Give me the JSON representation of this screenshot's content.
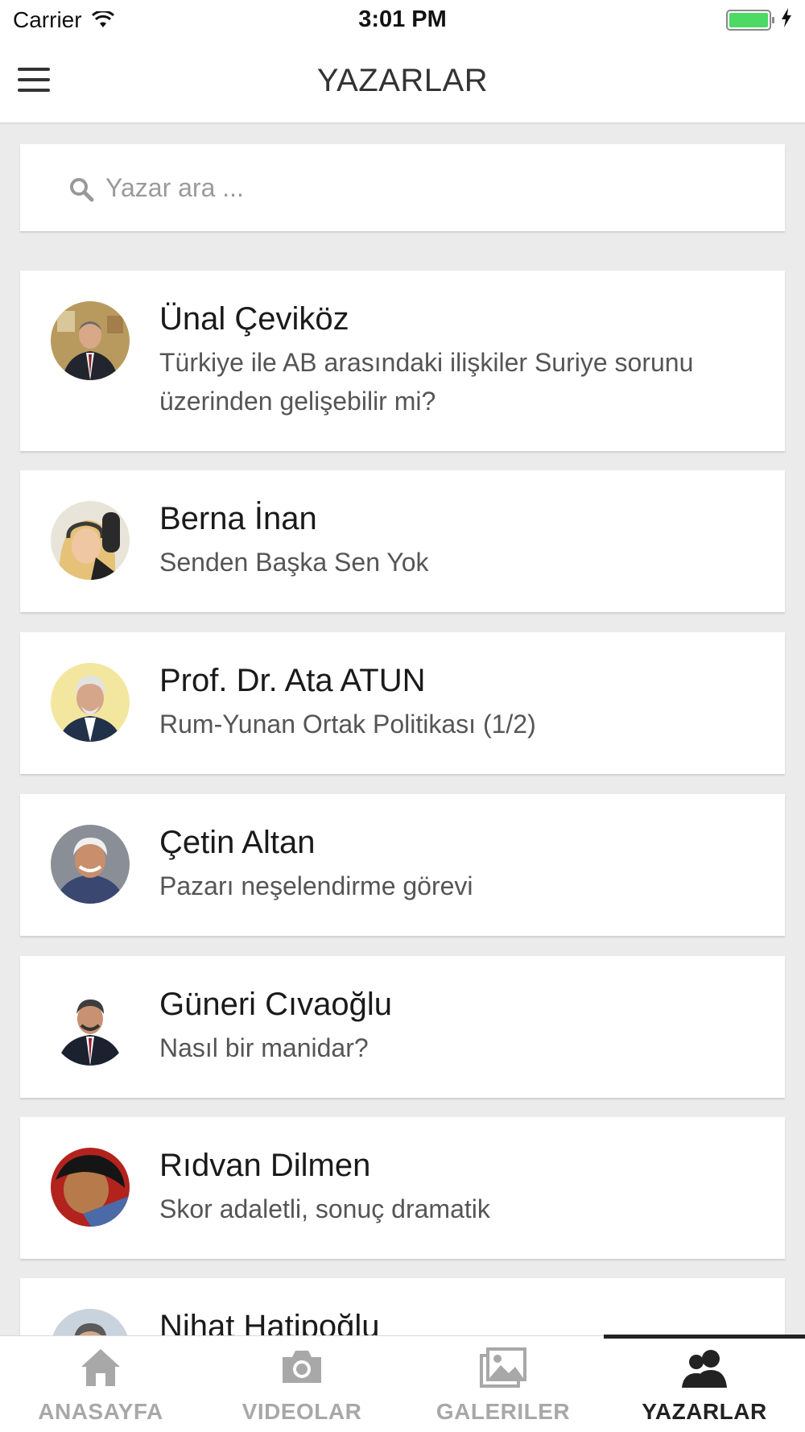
{
  "status_bar": {
    "carrier": "Carrier",
    "time": "3:01 PM"
  },
  "nav": {
    "title": "YAZARLAR"
  },
  "search": {
    "placeholder": "Yazar ara ..."
  },
  "authors": [
    {
      "name": "Ünal Çeviköz",
      "title": "Türkiye ile AB arasındaki ilişkiler Suriye sorunu üzerinden gelişebilir mi?"
    },
    {
      "name": "Berna İnan",
      "title": "Senden Başka Sen Yok"
    },
    {
      "name": "Prof. Dr. Ata ATUN",
      "title": "Rum-Yunan Ortak Politikası (1/2)"
    },
    {
      "name": "Çetin Altan",
      "title": "Pazarı neşelendirme görevi"
    },
    {
      "name": "Güneri Cıvaoğlu",
      "title": "Nasıl bir manidar?"
    },
    {
      "name": "Rıdvan Dilmen",
      "title": "Skor adaletli, sonuç dramatik"
    },
    {
      "name": "Nihat Hatipoğlu",
      "title": ""
    }
  ],
  "tabs": [
    {
      "label": "ANASAYFA",
      "icon": "home-icon"
    },
    {
      "label": "VIDEOLAR",
      "icon": "camera-icon"
    },
    {
      "label": "GALERILER",
      "icon": "gallery-icon"
    },
    {
      "label": "YAZARLAR",
      "icon": "authors-icon",
      "active": true
    }
  ],
  "colors": {
    "background": "#ebebeb",
    "card": "#ffffff",
    "battery": "#4cd964",
    "tab_inactive": "#a8a8a8",
    "tab_active": "#222222"
  }
}
